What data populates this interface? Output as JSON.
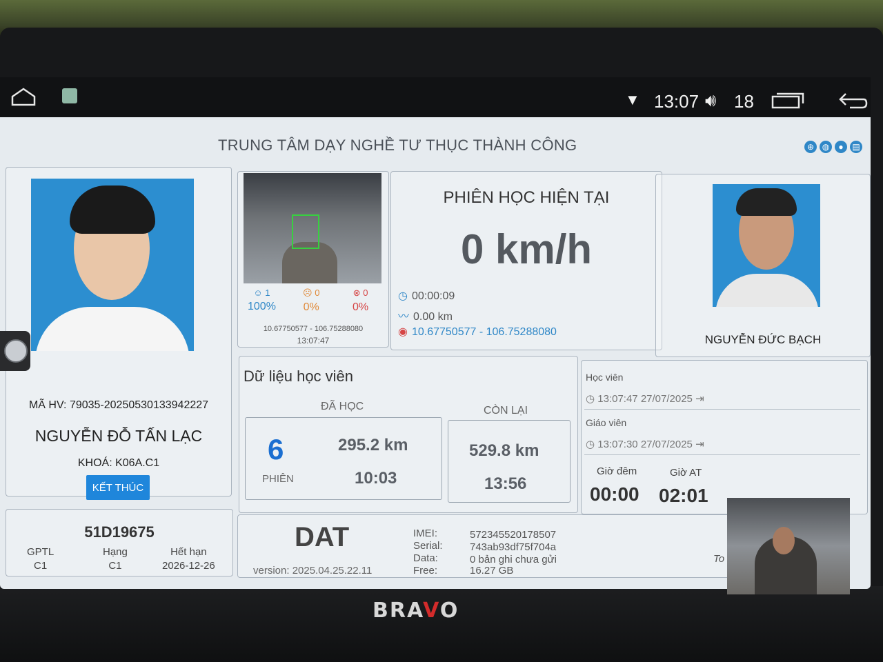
{
  "status_bar": {
    "time": "13:07",
    "volume_level": "18"
  },
  "header": {
    "title": "TRUNG TÂM DẠY NGHỀ TƯ THỤC THÀNH CÔNG"
  },
  "student": {
    "code_label": "MÃ HV: 79035-20250530133942227",
    "name": "NGUYỄN ĐỖ TẤN LẠC",
    "course": "KHOÁ: K06A.C1",
    "end_button": "KẾT THÚC"
  },
  "camera": {
    "stats": [
      {
        "count": "1",
        "pct": "100%",
        "color": "#2f87c7"
      },
      {
        "count": "0",
        "pct": "0%",
        "color": "#e08a3a"
      },
      {
        "count": "0",
        "pct": "0%",
        "color": "#d64545"
      }
    ],
    "coords": "10.67750577 - 106.75288080",
    "time": "13:07:47"
  },
  "session": {
    "title": "PHIÊN HỌC HIỆN TẠI",
    "speed": "0 km/h",
    "duration": "00:00:09",
    "distance": "0.00 km",
    "gps": "10.67750577 - 106.75288080"
  },
  "teacher": {
    "name": "NGUYỄN ĐỨC BẠCH"
  },
  "student_data": {
    "title": "Dữ liệu học viên",
    "studied_label": "ĐÃ HỌC",
    "remaining_label": "CÒN LẠI",
    "sessions": "6",
    "sessions_label": "PHIÊN",
    "studied_km": "295.2 km",
    "studied_time": "10:03",
    "remaining_km": "529.8 km",
    "remaining_time": "13:56"
  },
  "history": {
    "student_label": "Học viên",
    "student_time": "13:07:47 27/07/2025",
    "teacher_label": "Giáo viên",
    "teacher_time": "13:07:30 27/07/2025",
    "night_label": "Giờ đêm",
    "night_value": "00:00",
    "auto_label": "Giờ AT",
    "auto_value": "02:01"
  },
  "license": {
    "plate": "51D19675",
    "cols": [
      {
        "label": "GPTL",
        "value": "C1"
      },
      {
        "label": "Hạng",
        "value": "C1"
      },
      {
        "label": "Hết hạn",
        "value": "2026-12-26"
      }
    ]
  },
  "device": {
    "name": "DAT",
    "version": "version: 2025.04.25.22.11",
    "imei_label": "IMEI:",
    "imei": "572345520178507",
    "serial_label": "Serial:",
    "serial": "743ab93df75f704a",
    "data_label": "Data:",
    "data": "0 bản ghi chưa gửi",
    "free_label": "Free:",
    "free": "16.27 GB"
  },
  "driver_cam": {
    "label": "To"
  },
  "brand": {
    "text": "BRAVO"
  }
}
